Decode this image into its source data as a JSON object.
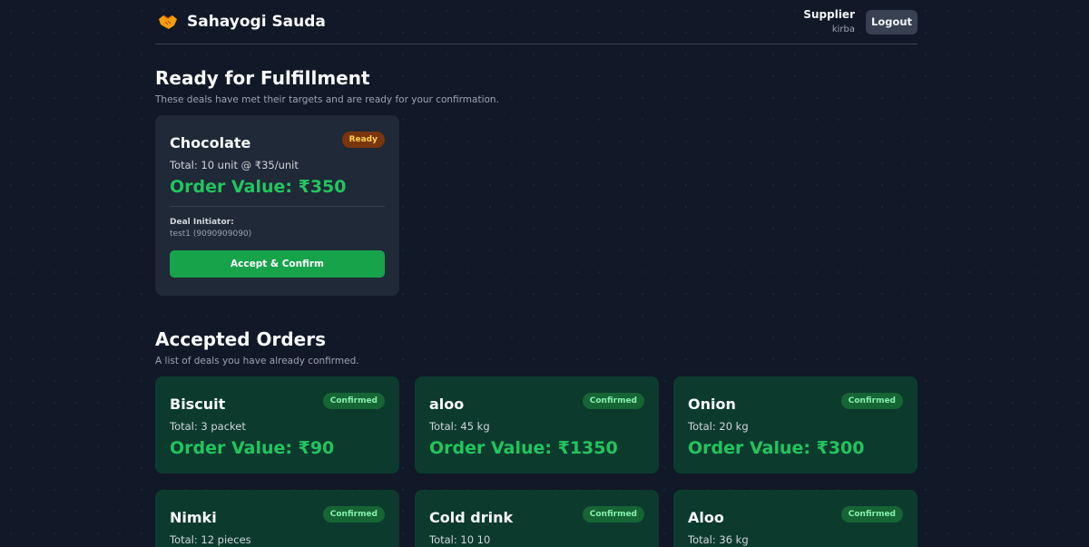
{
  "header": {
    "brand_name": "Sahayogi Sauda",
    "brand_icon": "handshake-icon",
    "user_role": "Supplier",
    "user_name": "kirba",
    "logout_label": "Logout"
  },
  "ready_section": {
    "title": "Ready for Fulfillment",
    "subtitle": "These deals have met their targets and are ready for your confirmation.",
    "deals": [
      {
        "name": "Chocolate",
        "status": "Ready",
        "total": "Total: 10 unit @ ₹35/unit",
        "order_value": "Order Value: ₹350",
        "initiator_label": "Deal Initiator:",
        "initiator": "test1 (9090909090)",
        "action_label": "Accept & Confirm"
      }
    ]
  },
  "accepted_section": {
    "title": "Accepted Orders",
    "subtitle": "A list of deals you have already confirmed.",
    "orders": [
      {
        "name": "Biscuit",
        "status": "Confirmed",
        "total": "Total: 3 packet",
        "order_value": "Order Value: ₹90"
      },
      {
        "name": "aloo",
        "status": "Confirmed",
        "total": "Total: 45 kg",
        "order_value": "Order Value: ₹1350"
      },
      {
        "name": "Onion",
        "status": "Confirmed",
        "total": "Total: 20 kg",
        "order_value": "Order Value: ₹300"
      },
      {
        "name": "Nimki",
        "status": "Confirmed",
        "total": "Total: 12 pieces",
        "order_value": ""
      },
      {
        "name": "Cold drink",
        "status": "Confirmed",
        "total": "Total: 10 10",
        "order_value": ""
      },
      {
        "name": "Aloo",
        "status": "Confirmed",
        "total": "Total: 36 kg",
        "order_value": ""
      }
    ]
  },
  "colors": {
    "background": "#111827",
    "card_ready": "#1f2937",
    "card_confirmed": "#0c3b2e",
    "accent_green": "#22c55e",
    "button_green": "#16a34a",
    "badge_ready": "#78350f"
  }
}
